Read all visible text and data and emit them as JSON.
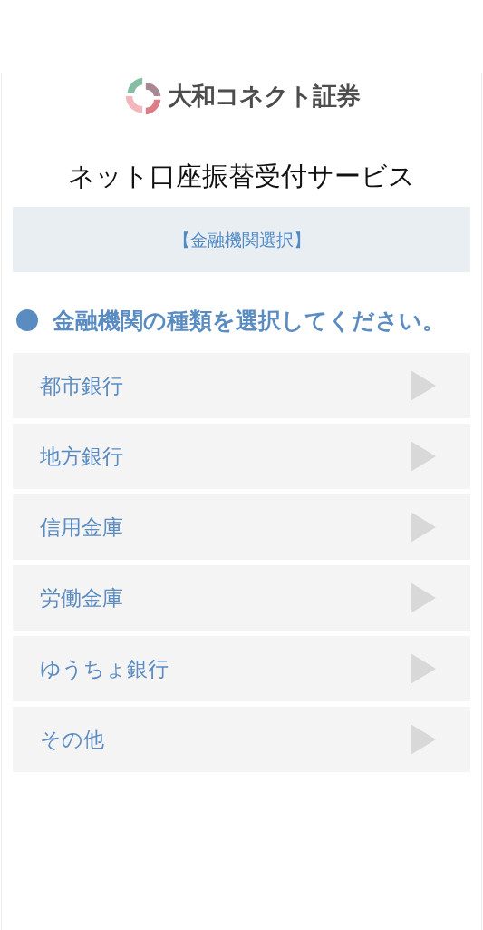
{
  "header": {
    "logo_text": "大和コネクト証券"
  },
  "page_title": "ネット口座振替受付サービス",
  "step_banner": "【金融機関選択】",
  "instruction": "金融機関の種類を選択してください。",
  "options": [
    {
      "label": "都市銀行"
    },
    {
      "label": "地方銀行"
    },
    {
      "label": "信用金庫"
    },
    {
      "label": "労働金庫"
    },
    {
      "label": "ゆうちょ銀行"
    },
    {
      "label": "その他"
    }
  ]
}
